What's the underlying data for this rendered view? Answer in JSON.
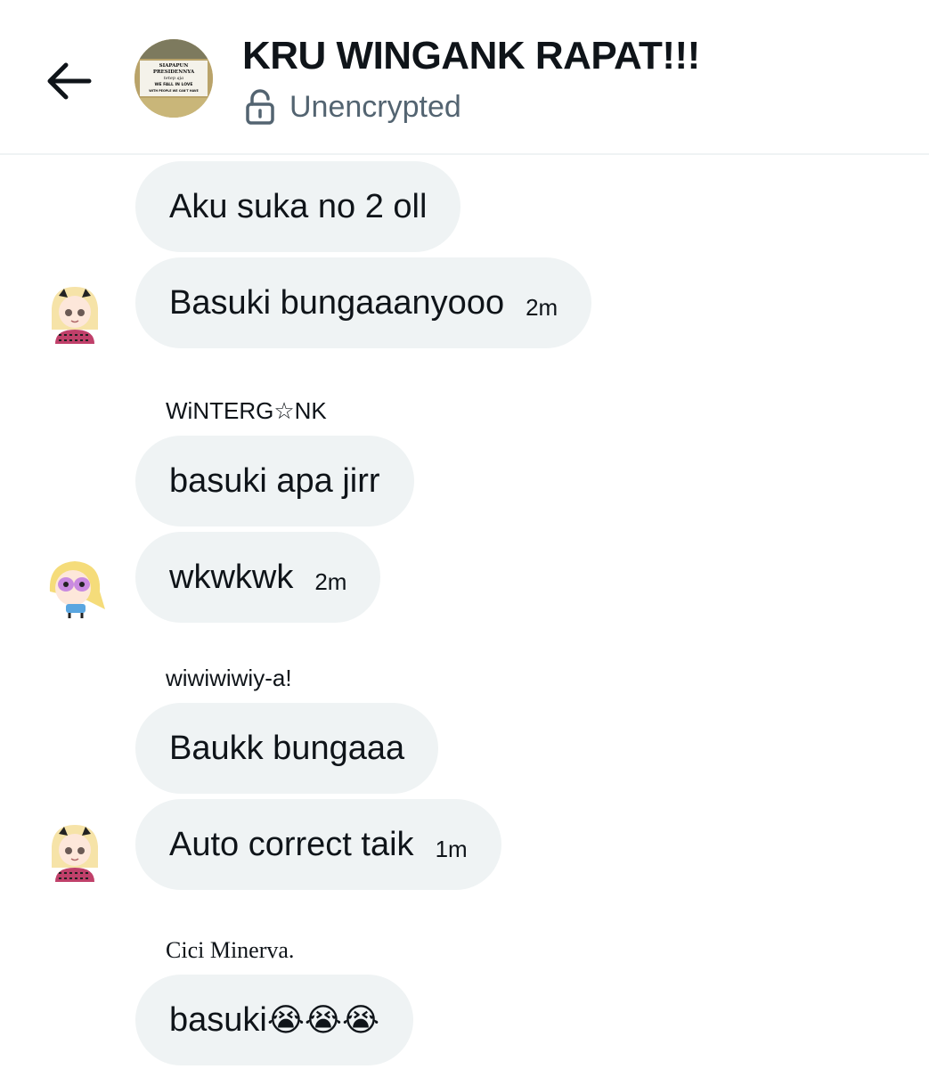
{
  "header": {
    "back_icon": "arrow-left-icon",
    "title": "KRU WINGANK RAPAT!!!",
    "encryption_status": "Unencrypted",
    "lock_icon": "unlocked-padlock-icon",
    "avatar_sign": {
      "line1": "SIAPAPUN",
      "line2": "PRESIDENNYA",
      "line3": "tetep aja",
      "line4": "WE FALL IN LOVE",
      "line5": "WITH PEOPLE WE CAN'T HAVE"
    }
  },
  "messages": [
    {
      "text": "Aku suka no 2  oll"
    },
    {
      "text": "Basuki bungaaanyooo",
      "time": "2m"
    },
    {
      "sender": "WiNTERG☆NK"
    },
    {
      "text": "basuki apa jirr"
    },
    {
      "text": "wkwkwk",
      "time": "2m"
    },
    {
      "sender": "wiwiwiwiy-a!"
    },
    {
      "text": "Baukk bungaaa"
    },
    {
      "text": "Auto correct taik",
      "time": "1m"
    },
    {
      "sender": "Cici Minerva."
    },
    {
      "text": "basuki",
      "emoji": "😭😭😭"
    }
  ]
}
